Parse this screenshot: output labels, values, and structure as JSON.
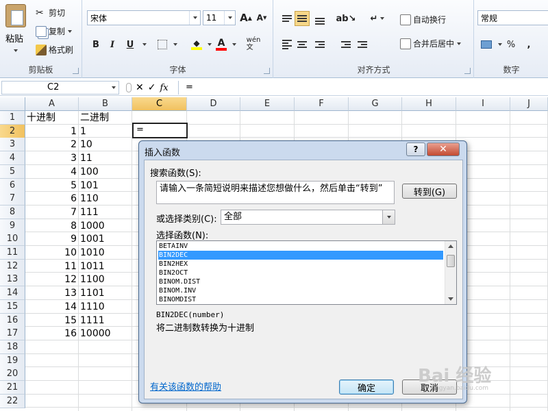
{
  "ribbon": {
    "clipboard": {
      "paste": "粘贴",
      "cut": "剪切",
      "copy": "复制",
      "format_painter": "格式刷",
      "title": "剪贴板"
    },
    "font": {
      "name": "宋体",
      "size": "11",
      "grow": "A",
      "shrink": "A",
      "bold": "B",
      "italic": "I",
      "underline": "U",
      "title": "字体"
    },
    "alignment": {
      "wrap": "自动换行",
      "merge": "合并后居中",
      "title": "对齐方式"
    },
    "number": {
      "format": "常规",
      "percent": "%",
      "comma": ",",
      "title": "数字"
    },
    "colors": {
      "fill": "#ffff00",
      "font_color": "#ff0000",
      "accent": "#f6d789"
    }
  },
  "formula_bar": {
    "name_box": "C2",
    "fx": "fx",
    "formula": "="
  },
  "grid": {
    "columns": [
      "A",
      "B",
      "C",
      "D",
      "E",
      "F",
      "G",
      "H",
      "I",
      "J"
    ],
    "rows": [
      "1",
      "2",
      "3",
      "4",
      "5",
      "6",
      "7",
      "8",
      "9",
      "10",
      "11",
      "12",
      "13",
      "14",
      "15",
      "16",
      "17",
      "18",
      "19",
      "20",
      "21",
      "22"
    ],
    "header_a": "十进制",
    "header_b": "二进制",
    "col_a": [
      "1",
      "2",
      "3",
      "4",
      "5",
      "6",
      "7",
      "8",
      "9",
      "10",
      "11",
      "12",
      "13",
      "14",
      "15",
      "16"
    ],
    "col_b": [
      "1",
      "10",
      "11",
      "100",
      "101",
      "110",
      "111",
      "1000",
      "1001",
      "1010",
      "1011",
      "1100",
      "1101",
      "1110",
      "1111",
      "10000"
    ],
    "active_cell_value": "="
  },
  "dialog": {
    "title": "插入函数",
    "help": "?",
    "close": "✕",
    "search_label": "搜索函数(S):",
    "search_value": "请输入一条简短说明来描述您想做什么，然后单击“转到”",
    "go_button": "转到(G)",
    "category_label": "或选择类别(C):",
    "category_value": "全部",
    "list_label": "选择函数(N):",
    "functions": [
      "BETAINV",
      "BIN2DEC",
      "BIN2HEX",
      "BIN2OCT",
      "BINOM.DIST",
      "BINOM.INV",
      "BINOMDIST"
    ],
    "selected_function": "BIN2DEC",
    "signature": "BIN2DEC(number)",
    "description": "将二进制数转换为十进制",
    "help_link": "有关该函数的帮助",
    "ok": "确定",
    "cancel": "取消"
  },
  "watermark": {
    "text": "Bai 经验",
    "url": "jingyan.baidu.com"
  }
}
